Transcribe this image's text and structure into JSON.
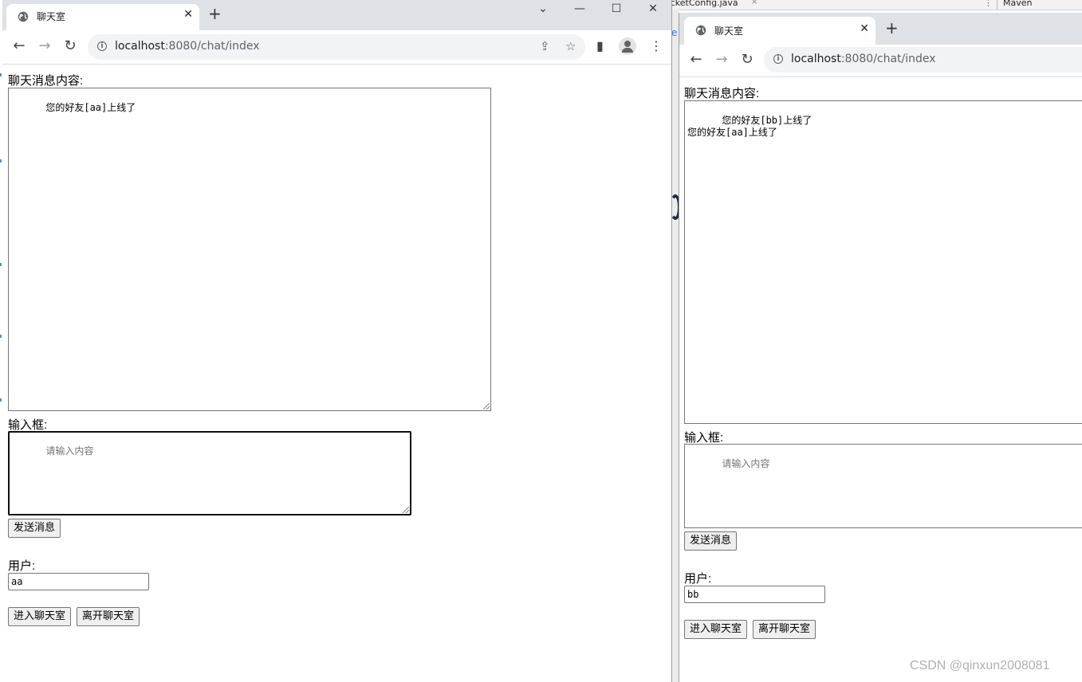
{
  "ide": {
    "tab_label": "ocketConfig.java",
    "tab_close": "×",
    "more": "⋮",
    "panel_label": "Maven",
    "fragment": "e"
  },
  "left_window": {
    "tab_title": "聊天室",
    "url_host": "localhost",
    "url_rest": ":8080/chat/index",
    "page": {
      "messages_label": "聊天消息内容:",
      "messages_text": "您的好友[aa]上线了",
      "input_label": "输入框:",
      "input_placeholder": "请输入内容",
      "send_button": "发送消息",
      "user_label": "用户:",
      "user_value": "aa",
      "enter_button": "进入聊天室",
      "leave_button": "离开聊天室"
    }
  },
  "right_window": {
    "tab_title": "聊天室",
    "url_host": "localhost",
    "url_rest": ":8080/chat/index",
    "page": {
      "messages_label": "聊天消息内容:",
      "messages_text": "您的好友[bb]上线了\n您的好友[aa]上线了",
      "input_label": "输入框:",
      "input_placeholder": "请输入内容",
      "send_button": "发送消息",
      "user_label": "用户:",
      "user_value": "bb",
      "enter_button": "进入聊天室",
      "leave_button": "离开聊天室"
    }
  },
  "icons": {
    "back": "←",
    "forward": "→",
    "reload": "↻",
    "close": "✕",
    "new_tab": "+",
    "minimize": "—",
    "maximize": "☐",
    "tab_search": "⌄",
    "share": "⇪",
    "star": "☆",
    "menu": "⋮",
    "side_panel": "▮"
  },
  "watermark": "CSDN @qinxun2008081"
}
